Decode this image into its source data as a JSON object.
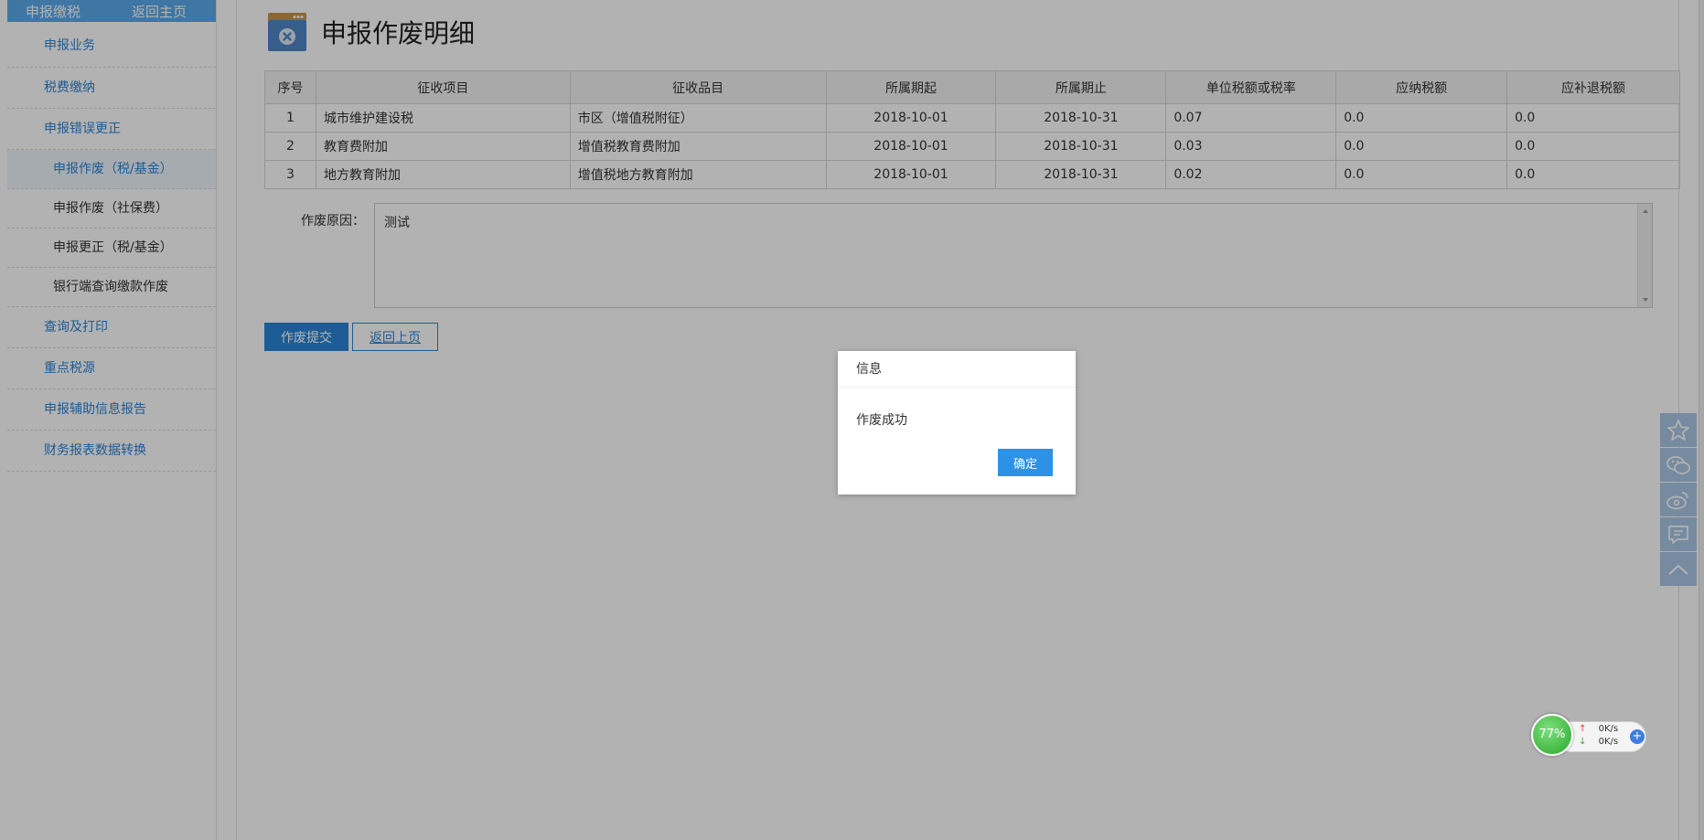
{
  "sidebar": {
    "head_left": "申报缴税",
    "head_right": "返回主页",
    "items": [
      {
        "label": "申报业务"
      },
      {
        "label": "税费缴纳"
      },
      {
        "label": "申报错误更正"
      },
      {
        "label": "申报作废（税/基金）"
      },
      {
        "label": "申报作废（社保费）"
      },
      {
        "label": "申报更正（税/基金）"
      },
      {
        "label": "银行端查询缴款作废"
      },
      {
        "label": "查询及打印"
      },
      {
        "label": "重点税源"
      },
      {
        "label": "申报辅助信息报告"
      },
      {
        "label": "财务报表数据转换"
      }
    ]
  },
  "page": {
    "title": "申报作废明细"
  },
  "table": {
    "headers": [
      "序号",
      "征收项目",
      "征收品目",
      "所属期起",
      "所属期止",
      "单位税额或税率",
      "应纳税额",
      "应补退税额"
    ],
    "rows": [
      {
        "no": "1",
        "item": "城市维护建设税",
        "category": "市区（增值税附征）",
        "start": "2018-10-01",
        "end": "2018-10-31",
        "rate": "0.07",
        "tax": "0.0",
        "refund": "0.0"
      },
      {
        "no": "2",
        "item": "教育费附加",
        "category": "增值税教育费附加",
        "start": "2018-10-01",
        "end": "2018-10-31",
        "rate": "0.03",
        "tax": "0.0",
        "refund": "0.0"
      },
      {
        "no": "3",
        "item": "地方教育附加",
        "category": "增值税地方教育附加",
        "start": "2018-10-01",
        "end": "2018-10-31",
        "rate": "0.02",
        "tax": "0.0",
        "refund": "0.0"
      }
    ]
  },
  "form": {
    "reason_label": "作废原因：",
    "reason_value": "测试",
    "submit_label": "作废提交",
    "back_label": "返回上页"
  },
  "dialog": {
    "title": "信息",
    "message": "作废成功",
    "ok_label": "确定"
  },
  "toolbar": {
    "icons": [
      "star-icon",
      "wechat-icon",
      "weibo-icon",
      "message-icon",
      "back-to-top-icon"
    ]
  },
  "network_widget": {
    "percent": "77%",
    "up_speed": "0K/s",
    "down_speed": "0K/s"
  },
  "colors": {
    "accent": "#2a84d6",
    "sidebar_head": "#5ba9ea",
    "overlay": "rgba(0,0,0,0.30)"
  }
}
